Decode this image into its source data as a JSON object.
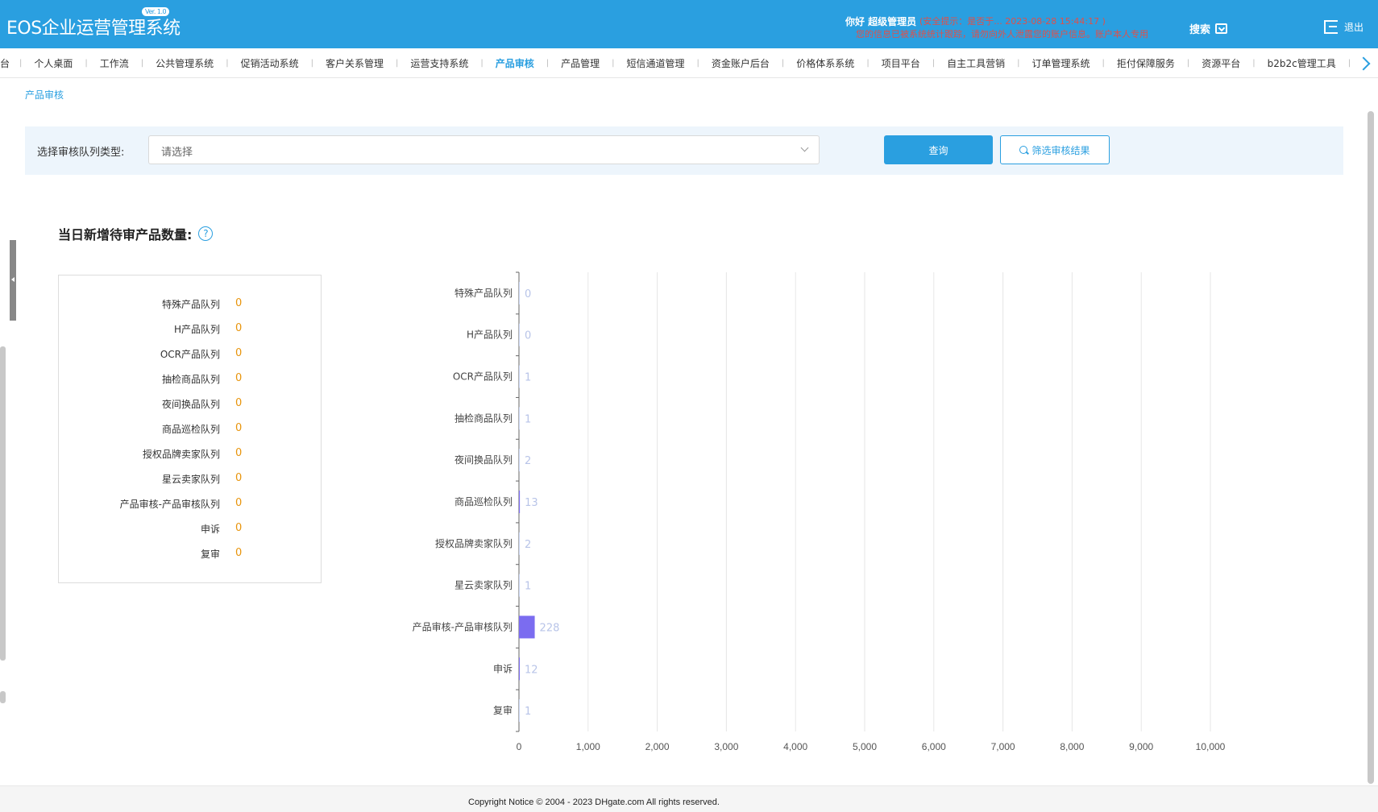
{
  "header": {
    "logo": "EOS企业运营管理系统",
    "version": "Ver. 1.0",
    "greeting": "你好 超级管理员",
    "notice_line1": "(安全提示：是否于... 2023-08-28 15:44:17 )",
    "notice_line2": "您的信息已被系统统计跟踪，请勿向外人泄露您的账户信息。账户本人专用",
    "search_label": "搜索",
    "logout_label": "退出"
  },
  "nav": {
    "items": [
      {
        "label": "台"
      },
      {
        "label": "个人桌面"
      },
      {
        "label": "工作流"
      },
      {
        "label": "公共管理系统"
      },
      {
        "label": "促销活动系统"
      },
      {
        "label": "客户关系管理"
      },
      {
        "label": "运营支持系统"
      },
      {
        "label": "产品审核",
        "active": true
      },
      {
        "label": "产品管理"
      },
      {
        "label": "短信通道管理"
      },
      {
        "label": "资金账户后台"
      },
      {
        "label": "价格体系系统"
      },
      {
        "label": "项目平台"
      },
      {
        "label": "自主工具营销"
      },
      {
        "label": "订单管理系统"
      },
      {
        "label": "拒付保障服务"
      },
      {
        "label": "资源平台"
      },
      {
        "label": "b2b2c管理工具"
      }
    ]
  },
  "breadcrumb": "产品审核",
  "filter": {
    "label": "选择审核队列类型:",
    "placeholder": "请选择",
    "query_button": "查询",
    "filter_button": "筛选审核结果"
  },
  "section_title": "当日新增待审产品数量:",
  "help_icon_glyph": "?",
  "counts": [
    {
      "name": "特殊产品队列",
      "value": "0"
    },
    {
      "name": "H产品队列",
      "value": "0"
    },
    {
      "name": "OCR产品队列",
      "value": "0"
    },
    {
      "name": "抽检商品队列",
      "value": "0"
    },
    {
      "name": "夜间换品队列",
      "value": "0"
    },
    {
      "name": "商品巡检队列",
      "value": "0"
    },
    {
      "name": "授权品牌卖家队列",
      "value": "0"
    },
    {
      "name": "星云卖家队列",
      "value": "0"
    },
    {
      "name": "产品审核-产品审核队列",
      "value": "0"
    },
    {
      "name": "申诉",
      "value": "0"
    },
    {
      "name": "复审",
      "value": "0"
    }
  ],
  "chart_data": {
    "type": "bar",
    "orientation": "horizontal",
    "categories": [
      "特殊产品队列",
      "H产品队列",
      "OCR产品队列",
      "抽检商品队列",
      "夜间换品队列",
      "商品巡检队列",
      "授权品牌卖家队列",
      "星云卖家队列",
      "产品审核-产品审核队列",
      "申诉",
      "复审"
    ],
    "values": [
      0,
      0,
      1,
      1,
      2,
      13,
      2,
      1,
      228,
      12,
      1
    ],
    "xlim": [
      0,
      10000
    ],
    "xticks": [
      "0",
      "1,000",
      "2,000",
      "3,000",
      "4,000",
      "5,000",
      "6,000",
      "7,000",
      "8,000",
      "9,000",
      "10,000"
    ],
    "grid": true,
    "bar_color": "#7b6cf0",
    "label_color": "#b8c4e8"
  },
  "footer": "Copyright Notice © 2004 - 2023 DHgate.com All rights reserved.",
  "colors": {
    "brand": "#2a9fe0",
    "count_value": "#e8940b"
  }
}
